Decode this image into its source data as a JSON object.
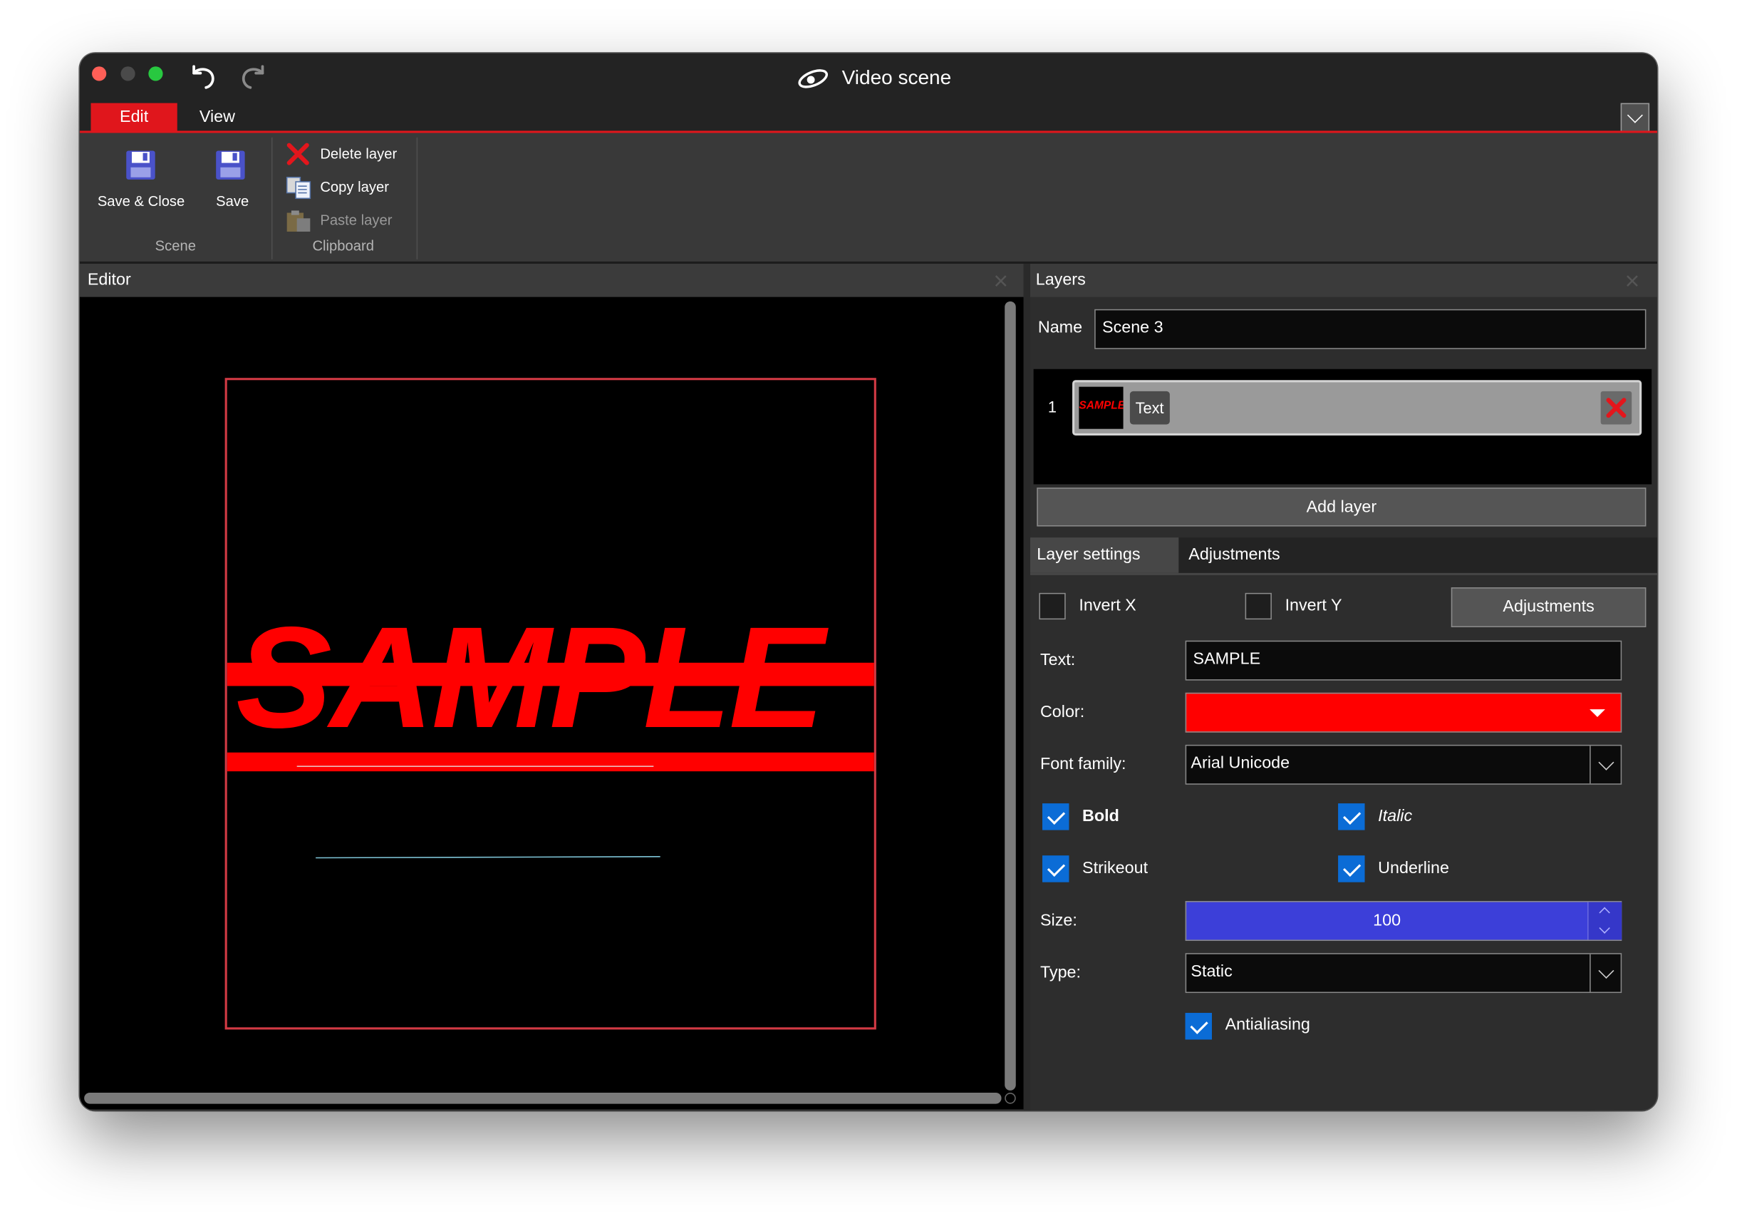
{
  "window": {
    "title": "Video scene"
  },
  "menu": {
    "tabs": [
      {
        "label": "Edit"
      },
      {
        "label": "View"
      }
    ]
  },
  "ribbon": {
    "save_close": "Save & Close",
    "save": "Save",
    "scene_group": "Scene",
    "delete_layer": "Delete layer",
    "copy_layer": "Copy layer",
    "paste_layer": "Paste layer",
    "clipboard_group": "Clipboard"
  },
  "editor": {
    "title": "Editor",
    "canvas_text": "SAMPLE",
    "text_color": "#ff0000",
    "frame_color": "#d23a44"
  },
  "layers": {
    "title": "Layers",
    "name_label": "Name",
    "name_value": "Scene 3",
    "items": [
      {
        "index": "1",
        "label": "Text",
        "thumb_text": "SAMPLE"
      }
    ],
    "add_layer": "Add layer"
  },
  "settings": {
    "tabs": [
      {
        "label": "Layer settings"
      },
      {
        "label": "Adjustments"
      }
    ],
    "invert_x": {
      "label": "Invert X",
      "checked": false
    },
    "invert_y": {
      "label": "Invert Y",
      "checked": false
    },
    "adjustments_button": "Adjustments",
    "text_label": "Text:",
    "text_value": "SAMPLE",
    "color_label": "Color:",
    "color_value": "#ff0000",
    "font_label": "Font family:",
    "font_value": "Arial Unicode",
    "bold": {
      "label": "Bold",
      "checked": true
    },
    "italic": {
      "label": "Italic",
      "checked": true
    },
    "strikeout": {
      "label": "Strikeout",
      "checked": true
    },
    "underline": {
      "label": "Underline",
      "checked": true
    },
    "size_label": "Size:",
    "size_value": "100",
    "type_label": "Type:",
    "type_value": "Static",
    "antialiasing": {
      "label": "Antialiasing",
      "checked": true
    }
  },
  "icons": {
    "undo": "undo-icon",
    "redo": "redo-icon",
    "app": "app-logo-icon",
    "save": "floppy-disk-icon",
    "delete": "red-x-icon",
    "copy": "copy-icon",
    "paste": "paste-icon",
    "collapse": "chevron-down-icon",
    "close": "close-icon"
  },
  "colors": {
    "accent": "#e0161c",
    "size_field": "#3c3fd9",
    "checkbox": "#0b6cd6"
  }
}
